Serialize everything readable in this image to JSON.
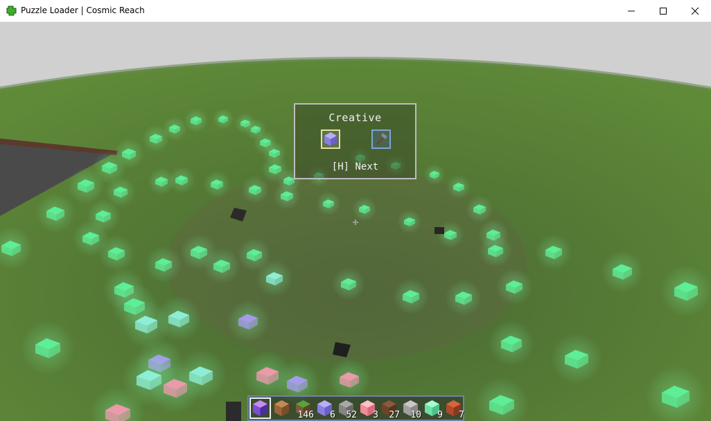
{
  "window": {
    "title": "Puzzle Loader | Cosmic Reach",
    "controls": [
      "minimize-icon",
      "maximize-icon",
      "close-icon"
    ]
  },
  "game": {
    "mode_panel": {
      "title": "Creative",
      "items": [
        {
          "icon": "lunar-block-icon",
          "selected": true
        },
        {
          "icon": "axe-icon",
          "selected": false
        }
      ],
      "next_hint": "[H] Next"
    },
    "hotbar": {
      "slots": [
        {
          "icon": "crafting-block-icon",
          "count": "",
          "selected": true
        },
        {
          "icon": "wood-planks-icon",
          "count": ""
        },
        {
          "icon": "grass-block-icon",
          "count": "146"
        },
        {
          "icon": "lunar-block-icon",
          "count": "6"
        },
        {
          "icon": "stone-block-icon",
          "count": "52"
        },
        {
          "icon": "pink-light-icon",
          "count": "3"
        },
        {
          "icon": "dirt-block-icon",
          "count": "27"
        },
        {
          "icon": "gray-block-icon",
          "count": "10"
        },
        {
          "icon": "green-light-icon",
          "count": "9"
        },
        {
          "icon": "brick-block-icon",
          "count": "7"
        }
      ]
    },
    "colors": {
      "sky": "#d2d2d2",
      "ground": "#557a35",
      "green_light": "#5df29a",
      "cyan_light": "#8ff2dc",
      "purple_light": "#a89cf2",
      "pink_light": "#f29ab0"
    }
  }
}
